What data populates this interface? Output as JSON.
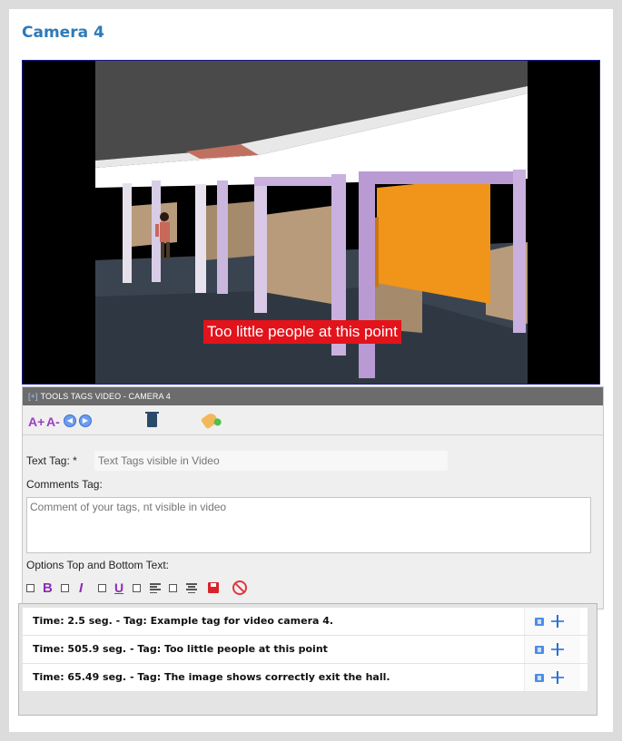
{
  "panel": {
    "title": "Camera 4"
  },
  "video": {
    "overlay_tag": "Too little people at this point"
  },
  "tools": {
    "plus": "[+]",
    "header": "TOOLS TAGS VIDEO - CAMERA 4",
    "font_increase": "A+",
    "font_decrease": "A-",
    "icons": [
      "font-increase-icon",
      "font-decrease-icon",
      "previous-icon",
      "next-icon",
      "trash-icon",
      "tag-icon"
    ]
  },
  "form": {
    "text_tag_label": "Text Tag: *",
    "text_tag_placeholder": "Text Tags visible in Video",
    "comments_label": "Comments Tag:",
    "comments_placeholder": "Comment of your tags, nt visible in video",
    "options_label": "Options Top and Bottom Text:",
    "bold": "B",
    "italic": "I",
    "underline": "U"
  },
  "tags_list": [
    {
      "text": "Time: 2.5 seg. - Tag: Example tag for video camera 4."
    },
    {
      "text": "Time: 505.9 seg. - Tag: Too little people at this point"
    },
    {
      "text": "Time: 65.49 seg. - Tag: The image shows correctly exit the hall."
    }
  ],
  "colors": {
    "title": "#2e7ab8",
    "overlay_bg": "#e3131b",
    "header_bg": "#6c6c6c",
    "icon_purple": "#8e2bb5",
    "icon_blue": "#4e8ee4"
  }
}
